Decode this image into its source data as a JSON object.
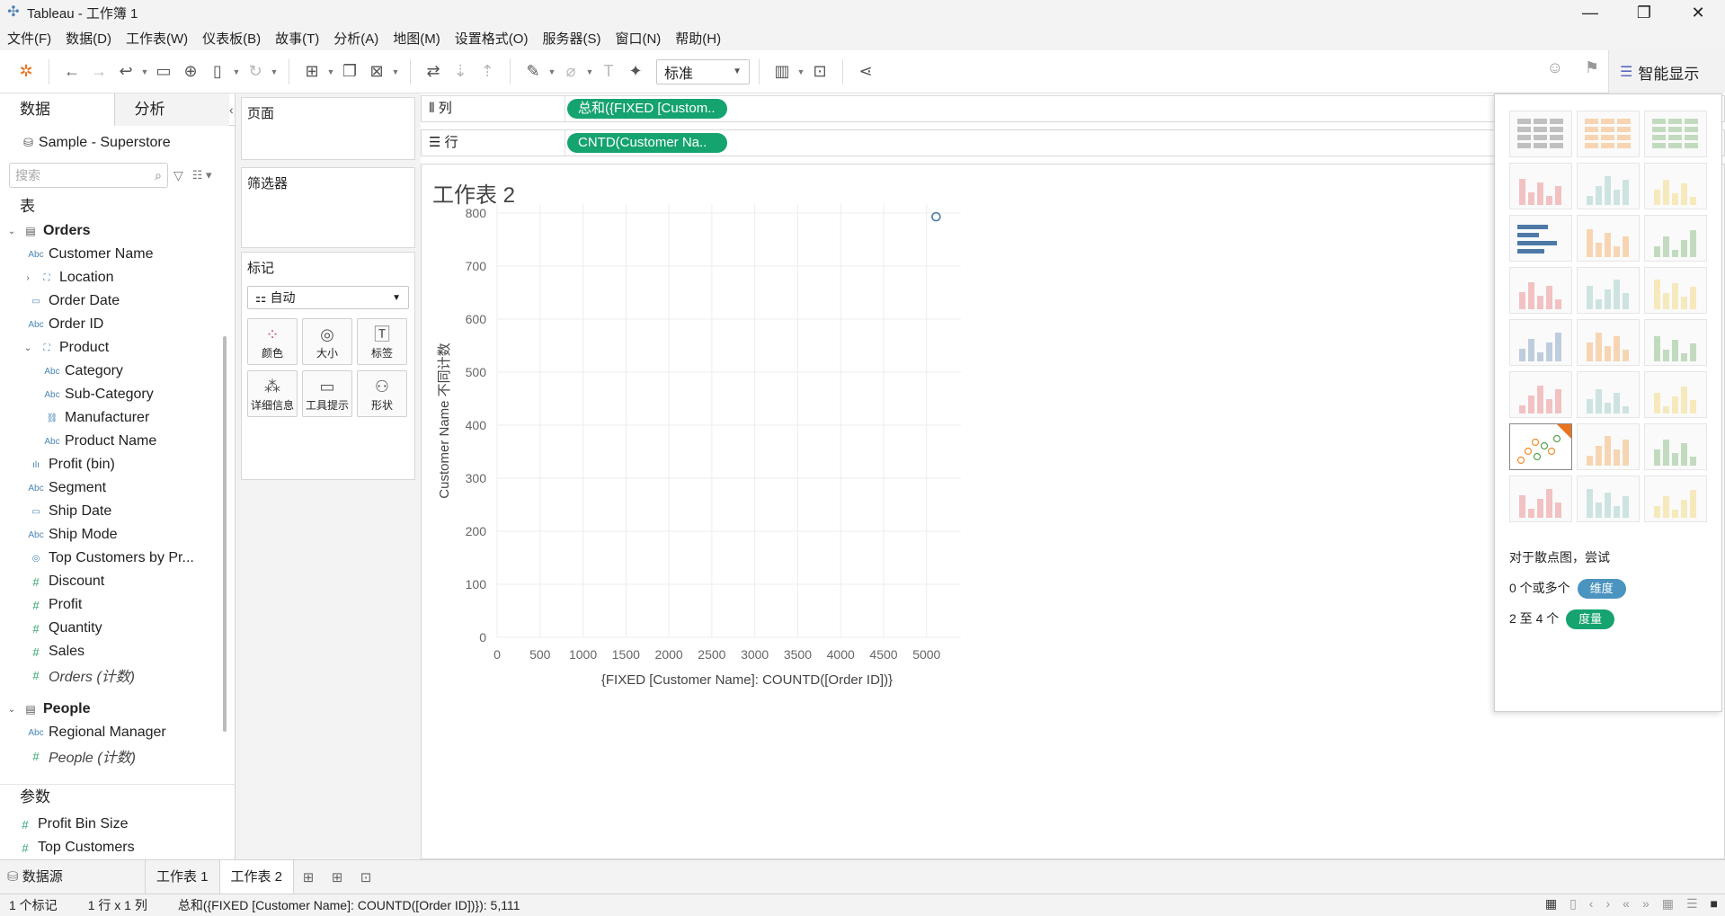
{
  "window": {
    "title": "Tableau - 工作簿 1",
    "minimize": "—",
    "maximize": "❐",
    "close": "✕"
  },
  "menu": [
    "文件(F)",
    "数据(D)",
    "工作表(W)",
    "仪表板(B)",
    "故事(T)",
    "分析(A)",
    "地图(M)",
    "设置格式(O)",
    "服务器(S)",
    "窗口(N)",
    "帮助(H)"
  ],
  "toolbar": {
    "fit": "标准",
    "show_me": "智能显示"
  },
  "data_pane": {
    "tab_data": "数据",
    "tab_analysis": "分析",
    "datasource": "Sample - Superstore",
    "search_placeholder": "搜索",
    "tables_title": "表",
    "fields": [
      {
        "label": "Orders",
        "type": "table",
        "level": 0,
        "expand": "v",
        "bold": true
      },
      {
        "label": "Customer Name",
        "type": "dim",
        "level": 1
      },
      {
        "label": "Location",
        "type": "hier",
        "level": 1,
        "expand": ">"
      },
      {
        "label": "Order Date",
        "type": "date",
        "level": 1
      },
      {
        "label": "Order ID",
        "type": "dim",
        "level": 1
      },
      {
        "label": "Product",
        "type": "hier",
        "level": 1,
        "expand": "v"
      },
      {
        "label": "Category",
        "type": "dim",
        "level": 2
      },
      {
        "label": "Sub-Category",
        "type": "dim",
        "level": 2
      },
      {
        "label": "Manufacturer",
        "type": "group",
        "level": 2
      },
      {
        "label": "Product Name",
        "type": "dim",
        "level": 2
      },
      {
        "label": "Profit (bin)",
        "type": "bin",
        "level": 1
      },
      {
        "label": "Segment",
        "type": "dim",
        "level": 1
      },
      {
        "label": "Ship Date",
        "type": "date",
        "level": 1
      },
      {
        "label": "Ship Mode",
        "type": "dim",
        "level": 1
      },
      {
        "label": "Top Customers by Pr...",
        "type": "set",
        "level": 1
      },
      {
        "label": "Discount",
        "type": "meas",
        "level": 1
      },
      {
        "label": "Profit",
        "type": "meas",
        "level": 1
      },
      {
        "label": "Quantity",
        "type": "meas",
        "level": 1
      },
      {
        "label": "Sales",
        "type": "meas",
        "level": 1
      },
      {
        "label": "Orders (计数)",
        "type": "meas",
        "level": 1,
        "italic": true
      },
      {
        "label": "People",
        "type": "table",
        "level": 0,
        "expand": "v",
        "bold": true
      },
      {
        "label": "Regional Manager",
        "type": "dim",
        "level": 1
      },
      {
        "label": "People (计数)",
        "type": "meas",
        "level": 1,
        "italic": true
      }
    ],
    "params_title": "参数",
    "params": [
      "Profit Bin Size",
      "Top Customers"
    ]
  },
  "cards": {
    "pages": "页面",
    "filters": "筛选器",
    "marks": "标记",
    "mark_type": "自动",
    "mark_buttons": [
      {
        "label": "颜色",
        "icon": "color-icon"
      },
      {
        "label": "大小",
        "icon": "size-icon"
      },
      {
        "label": "标签",
        "icon": "label-icon"
      },
      {
        "label": "详细信息",
        "icon": "detail-icon"
      },
      {
        "label": "工具提示",
        "icon": "tooltip-icon"
      },
      {
        "label": "形状",
        "icon": "shape-icon"
      }
    ]
  },
  "shelves": {
    "columns_label": "列",
    "rows_label": "行",
    "columns_pill": "总和({FIXED [Custom..",
    "rows_pill": "CNTD(Customer Na.."
  },
  "view": {
    "title": "工作表 2"
  },
  "chart_data": {
    "type": "scatter",
    "xlabel": "{FIXED [Customer Name]: COUNTD([Order ID])}",
    "ylabel": "Customer Name 不同计数",
    "xlim": [
      0,
      5400
    ],
    "ylim": [
      0,
      800
    ],
    "xticks": [
      0,
      500,
      1000,
      1500,
      2000,
      2500,
      3000,
      3500,
      4000,
      4500,
      5000
    ],
    "yticks": [
      0,
      100,
      200,
      300,
      400,
      500,
      600,
      700,
      800
    ],
    "points": [
      {
        "x": 5111,
        "y": 793
      }
    ],
    "grid": true,
    "color": "#4e79a7"
  },
  "show_me": {
    "hint_title": "对于散点图，尝试",
    "req1_prefix": "0 个或多个",
    "req1_chip": "维度",
    "req2_prefix": "2 至 4 个",
    "req2_chip": "度量",
    "dim_color": "#4a94bf",
    "meas_color": "#15a36f"
  },
  "tabs": {
    "datasource": "数据源",
    "sheet1": "工作表 1",
    "sheet2": "工作表 2"
  },
  "status": {
    "marks": "1 个标记",
    "rowscols": "1 行 x 1 列",
    "sum": "总和({FIXED [Customer Name]: COUNTD([Order ID])}): 5,111"
  }
}
